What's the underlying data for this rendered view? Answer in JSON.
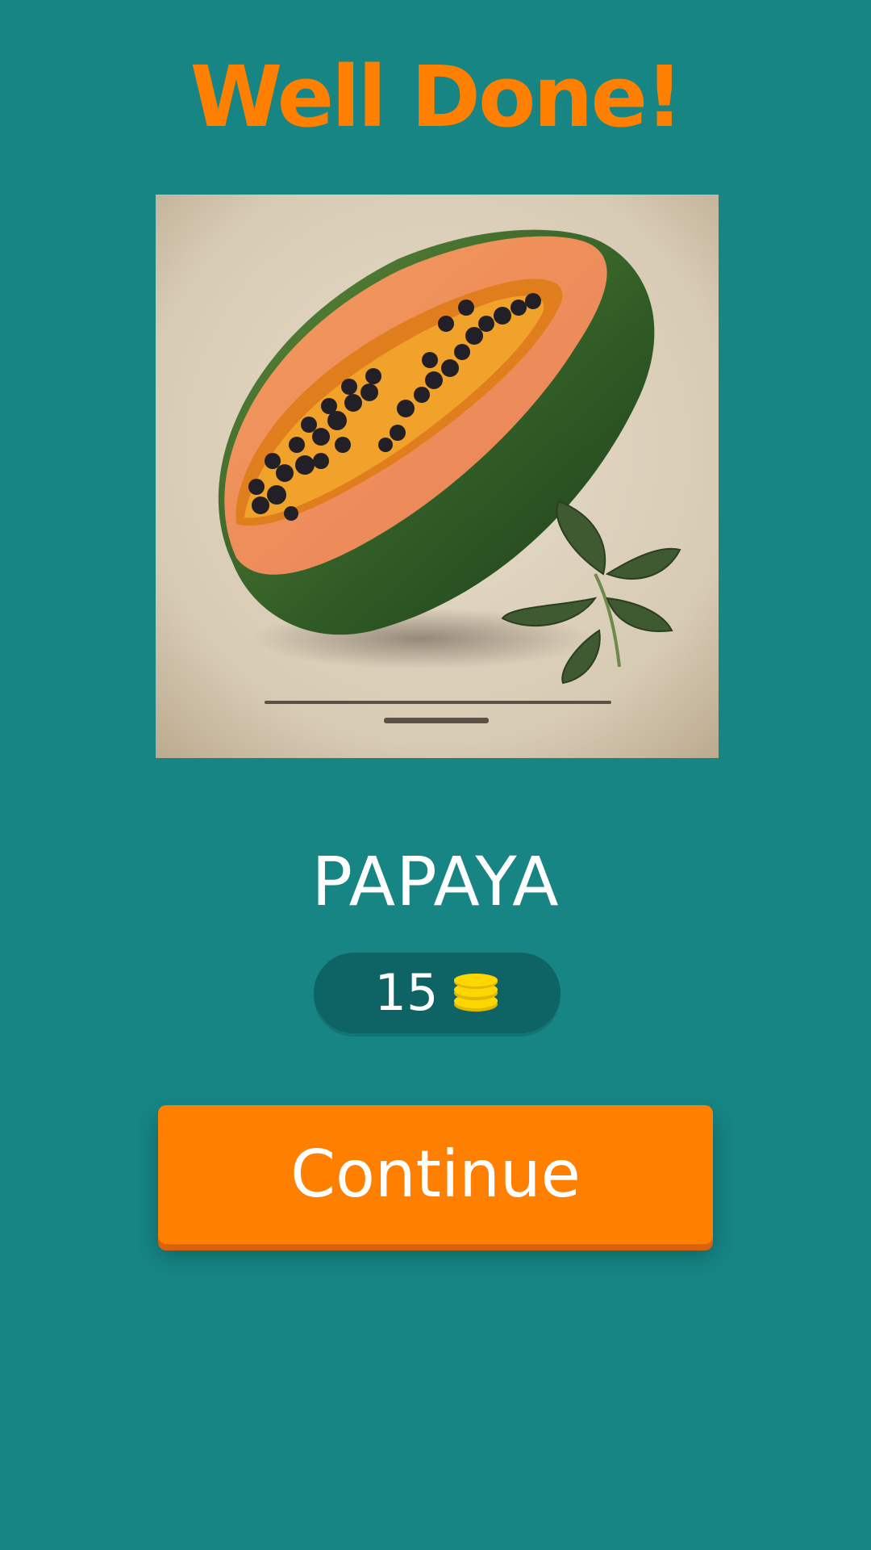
{
  "header": {
    "title": "Well Done!"
  },
  "puzzle": {
    "image_subject": "papaya-illustration",
    "answer": "PAPAYA"
  },
  "reward": {
    "amount": "15",
    "icon": "coin-stack-icon",
    "coin_color": "#FFD700"
  },
  "actions": {
    "continue_label": "Continue"
  },
  "colors": {
    "background": "#168584",
    "accent": "#FF7F00",
    "pill": "#0E6464"
  }
}
